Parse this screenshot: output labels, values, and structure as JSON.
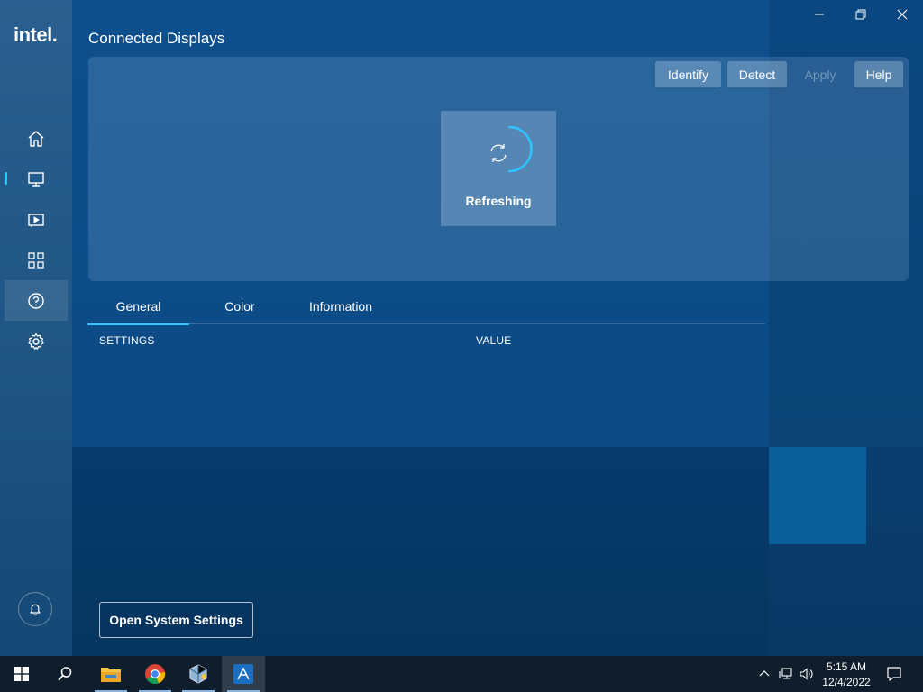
{
  "app": {
    "logo_text": "intel.",
    "page_title": "Connected Displays"
  },
  "toolbar": {
    "identify_label": "Identify",
    "detect_label": "Detect",
    "apply_label": "Apply",
    "help_label": "Help"
  },
  "display_area": {
    "status_label": "Refreshing"
  },
  "tabs": [
    {
      "label": "General",
      "active": true
    },
    {
      "label": "Color",
      "active": false
    },
    {
      "label": "Information",
      "active": false
    }
  ],
  "table": {
    "headers": [
      "SETTINGS",
      "VALUE"
    ]
  },
  "footer": {
    "open_settings_label": "Open System Settings"
  },
  "sidebar": {
    "items": [
      {
        "icon": "home-icon",
        "active": false
      },
      {
        "icon": "monitor-icon",
        "active": true
      },
      {
        "icon": "video-icon",
        "active": false
      },
      {
        "icon": "apps-grid-icon",
        "active": false
      },
      {
        "icon": "help-icon",
        "active": false,
        "hovered": true
      },
      {
        "icon": "gear-icon",
        "active": false
      }
    ],
    "bell_icon": "bell-icon"
  },
  "taskbar": {
    "time": "5:15 AM",
    "date": "12/4/2022"
  },
  "colors": {
    "accent": "#2ec4ff",
    "background": "#0b4a86",
    "taskbar": "#0f1d2c"
  }
}
